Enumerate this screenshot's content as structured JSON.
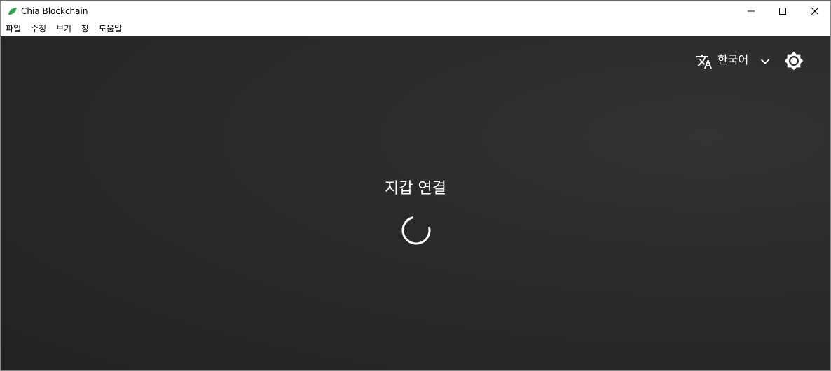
{
  "window": {
    "title": "Chia Blockchain",
    "icon": "chia-leaf-icon",
    "controls": [
      "minimize-icon",
      "maximize-icon",
      "close-icon"
    ]
  },
  "menu": {
    "items": [
      "파일",
      "수정",
      "보기",
      "창",
      "도움말"
    ]
  },
  "header": {
    "language_icon": "translate-icon",
    "language_label": "한국어",
    "dropdown_icon": "chevron-down-icon",
    "theme_icon": "brightness-icon"
  },
  "main": {
    "status_title": "지갑 연결",
    "loading_icon": "spinner-icon"
  },
  "colors": {
    "background": "#2a2a2a",
    "text": "#ffffff",
    "leaf_green": "#3aac59"
  }
}
